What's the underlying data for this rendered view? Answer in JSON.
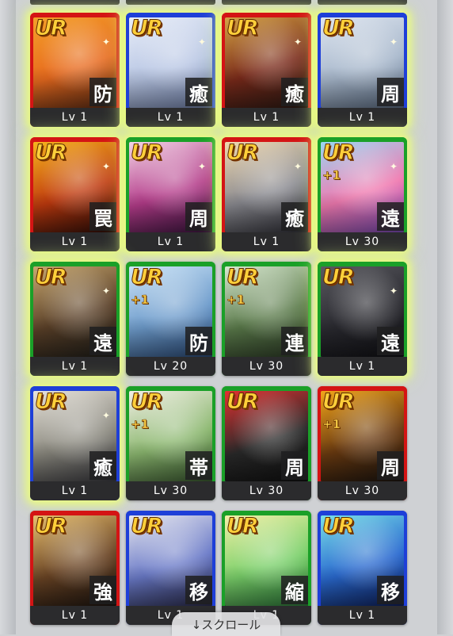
{
  "scroll_hint": "↓スクロール",
  "colors": {
    "red": "#d41414",
    "blue": "#1e3fd8",
    "green": "#1aa028",
    "glow": "#eeff78"
  },
  "cards": [
    {
      "rarity": "UR",
      "plus": "",
      "role": "防",
      "level": "Lv 1",
      "color": "red",
      "glow": true,
      "art": [
        "#f3a12a",
        "#e86a1e",
        "#5a2a14"
      ]
    },
    {
      "rarity": "UR",
      "plus": "",
      "role": "癒",
      "level": "Lv 1",
      "color": "blue",
      "glow": true,
      "art": [
        "#e9eef8",
        "#b8c6e4",
        "#6f7fa8"
      ]
    },
    {
      "rarity": "UR",
      "plus": "",
      "role": "癒",
      "level": "Lv 1",
      "color": "red",
      "glow": true,
      "art": [
        "#d4a445",
        "#7a2a1a",
        "#2a1a14"
      ]
    },
    {
      "rarity": "UR",
      "plus": "",
      "role": "周",
      "level": "Lv 1",
      "color": "blue",
      "glow": true,
      "art": [
        "#dfe6f0",
        "#a8b8cc",
        "#5e6f86"
      ]
    },
    {
      "rarity": "UR",
      "plus": "",
      "role": "罠",
      "level": "Lv 1",
      "color": "red",
      "glow": true,
      "art": [
        "#f6b51e",
        "#c03a0e",
        "#2a0c08"
      ]
    },
    {
      "rarity": "UR",
      "plus": "",
      "role": "周",
      "level": "Lv 1",
      "color": "green",
      "glow": true,
      "art": [
        "#f2d5e6",
        "#b43c8a",
        "#3a1440"
      ]
    },
    {
      "rarity": "UR",
      "plus": "",
      "role": "癒",
      "level": "Lv 1",
      "color": "red",
      "glow": true,
      "art": [
        "#f0d9b0",
        "#8a8a90",
        "#2e2e36"
      ]
    },
    {
      "rarity": "UR",
      "plus": "+1",
      "role": "遠",
      "level": "Lv 30",
      "color": "green",
      "glow": true,
      "art": [
        "#9ad7f2",
        "#f07ab0",
        "#7a4ab8"
      ]
    },
    {
      "rarity": "UR",
      "plus": "",
      "role": "遠",
      "level": "Lv 1",
      "color": "green",
      "glow": true,
      "art": [
        "#c8a870",
        "#5a4028",
        "#1e1e1a"
      ]
    },
    {
      "rarity": "UR",
      "plus": "+1",
      "role": "防",
      "level": "Lv 20",
      "color": "green",
      "glow": false,
      "art": [
        "#cfe6f8",
        "#6e9ccc",
        "#2a4a78"
      ]
    },
    {
      "rarity": "UR",
      "plus": "+1",
      "role": "連",
      "level": "Lv 30",
      "color": "green",
      "glow": false,
      "art": [
        "#d8e8d0",
        "#5a7a4a",
        "#2c3a26"
      ]
    },
    {
      "rarity": "UR",
      "plus": "",
      "role": "遠",
      "level": "Lv 1",
      "color": "green",
      "glow": true,
      "art": [
        "#5a5a60",
        "#2a2a30",
        "#101014"
      ]
    },
    {
      "rarity": "UR",
      "plus": "",
      "role": "癒",
      "level": "Lv 1",
      "color": "blue",
      "glow": true,
      "art": [
        "#e8e4dc",
        "#8c8a80",
        "#3a3a40"
      ]
    },
    {
      "rarity": "UR",
      "plus": "+1",
      "role": "帯",
      "level": "Lv 30",
      "color": "green",
      "glow": false,
      "art": [
        "#f2efe6",
        "#8cb870",
        "#3a5a30"
      ]
    },
    {
      "rarity": "UR",
      "plus": "",
      "role": "周",
      "level": "Lv 30",
      "color": "green",
      "glow": false,
      "art": [
        "#e23030",
        "#2a2a2a",
        "#101010"
      ]
    },
    {
      "rarity": "UR",
      "plus": "+1",
      "role": "周",
      "level": "Lv 30",
      "color": "red",
      "glow": false,
      "art": [
        "#f2a51a",
        "#6a3a10",
        "#1a1410"
      ]
    },
    {
      "rarity": "UR",
      "plus": "",
      "role": "強",
      "level": "Lv 1",
      "color": "red",
      "glow": false,
      "art": [
        "#e8c070",
        "#6a4424",
        "#1c1410"
      ]
    },
    {
      "rarity": "UR",
      "plus": "",
      "role": "移",
      "level": "Lv 1",
      "color": "blue",
      "glow": false,
      "art": [
        "#e8e8ee",
        "#6a7ac8",
        "#2a2a4a"
      ]
    },
    {
      "rarity": "UR",
      "plus": "",
      "role": "縮",
      "level": "Lv 1",
      "color": "green",
      "glow": false,
      "art": [
        "#f4f0a8",
        "#7ad06a",
        "#2c7a3a"
      ]
    },
    {
      "rarity": "UR",
      "plus": "",
      "role": "移",
      "level": "Lv 1",
      "color": "blue",
      "glow": false,
      "art": [
        "#7ae0e8",
        "#2a6ad0",
        "#0e1e5a"
      ]
    }
  ]
}
